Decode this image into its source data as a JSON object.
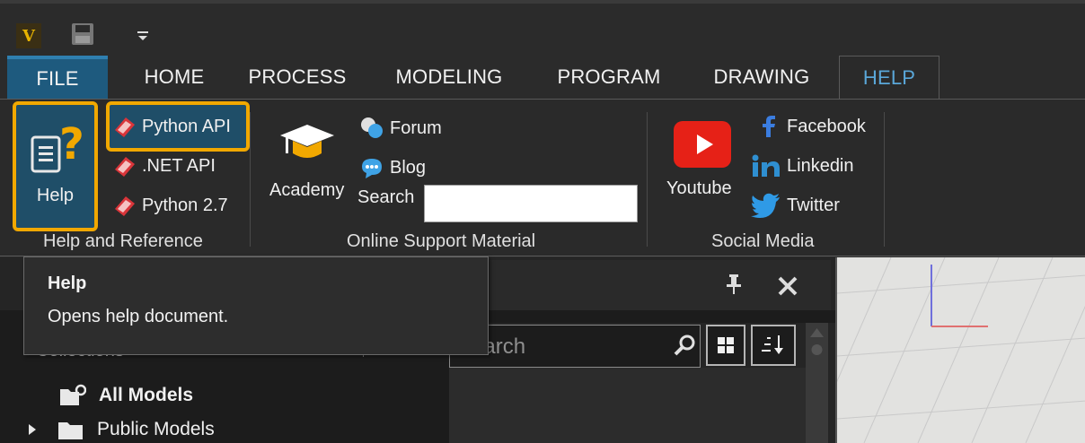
{
  "app": {
    "logo_letter": "V"
  },
  "tabs": [
    {
      "label": "FILE"
    },
    {
      "label": "HOME"
    },
    {
      "label": "PROCESS"
    },
    {
      "label": "MODELING"
    },
    {
      "label": "PROGRAM"
    },
    {
      "label": "DRAWING"
    },
    {
      "label": "HELP"
    }
  ],
  "ribbon": {
    "help_reference": {
      "help_label": "Help",
      "python_api_label": "Python API",
      "net_api_label": ".NET API",
      "python27_label": "Python 2.7",
      "group_label": "Help and Reference"
    },
    "online_support": {
      "academy_label": "Academy",
      "forum_label": "Forum",
      "blog_label": "Blog",
      "search_label": "Search",
      "search_value": "",
      "group_label": "Online Support Material"
    },
    "social_media": {
      "youtube_label": "Youtube",
      "facebook_label": "Facebook",
      "linkedin_label": "Linkedin",
      "twitter_label": "Twitter",
      "group_label": "Social Media"
    }
  },
  "tooltip": {
    "title": "Help",
    "body": "Opens help document."
  },
  "library": {
    "collections_label": "Collections",
    "collections_count": "0",
    "search_placeholder": "Search",
    "tree": [
      {
        "label": "All Models"
      },
      {
        "label": "Public Models"
      }
    ]
  },
  "colors": {
    "accent": "#1e5a7e",
    "highlight_outline": "#f1a800",
    "active_tab_text": "#5aa7d9"
  }
}
